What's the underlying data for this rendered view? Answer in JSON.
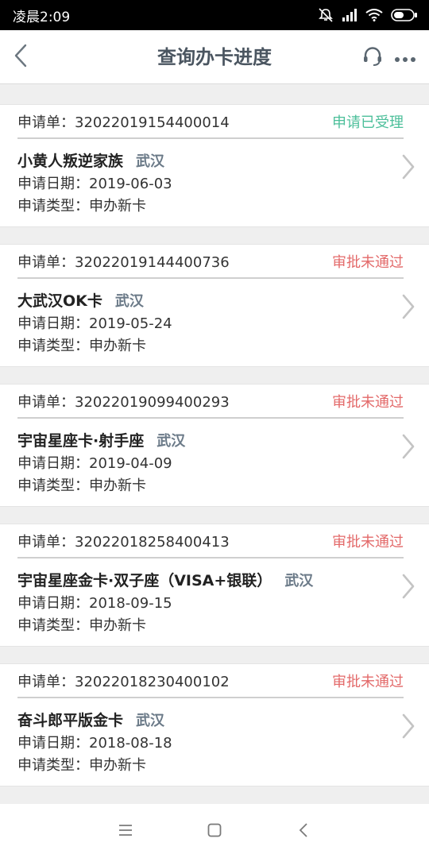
{
  "status_bar": {
    "time": "凌晨2:09",
    "icons": [
      "mute-icon",
      "signal-icon",
      "wifi-icon",
      "battery-icon"
    ]
  },
  "navbar": {
    "title": "查询办卡进度",
    "icons": [
      "back-icon",
      "customer-service-icon",
      "more-icon"
    ]
  },
  "colors": {
    "status_accepted": "#4cbf9a",
    "status_rejected": "#e36a6a",
    "city": "#6b7a88",
    "title": "#4a5560"
  },
  "applications": [
    {
      "number_label": "申请单：32022019154400014",
      "status": "申请已受理",
      "status_type": "accepted",
      "card_name": "小黄人叛逆家族",
      "city": "武汉",
      "date_label": "申请日期：2019-06-03",
      "type_label": "申请类型：申办新卡"
    },
    {
      "number_label": "申请单：32022019144400736",
      "status": "审批未通过",
      "status_type": "rejected",
      "card_name": "大武汉OK卡",
      "city": "武汉",
      "date_label": "申请日期：2019-05-24",
      "type_label": "申请类型：申办新卡"
    },
    {
      "number_label": "申请单：32022019099400293",
      "status": "审批未通过",
      "status_type": "rejected",
      "card_name": "宇宙星座卡·射手座",
      "city": "武汉",
      "date_label": "申请日期：2019-04-09",
      "type_label": "申请类型：申办新卡"
    },
    {
      "number_label": "申请单：32022018258400413",
      "status": "审批未通过",
      "status_type": "rejected",
      "card_name": "宇宙星座金卡·双子座（VISA+银联）",
      "city": "武汉",
      "date_label": "申请日期：2018-09-15",
      "type_label": "申请类型：申办新卡"
    },
    {
      "number_label": "申请单：32022018230400102",
      "status": "审批未通过",
      "status_type": "rejected",
      "card_name": "奋斗郎平版金卡",
      "city": "武汉",
      "date_label": "申请日期：2018-08-18",
      "type_label": "申请类型：申办新卡"
    }
  ],
  "system_nav": [
    "menu-icon",
    "home-icon",
    "back-icon"
  ]
}
